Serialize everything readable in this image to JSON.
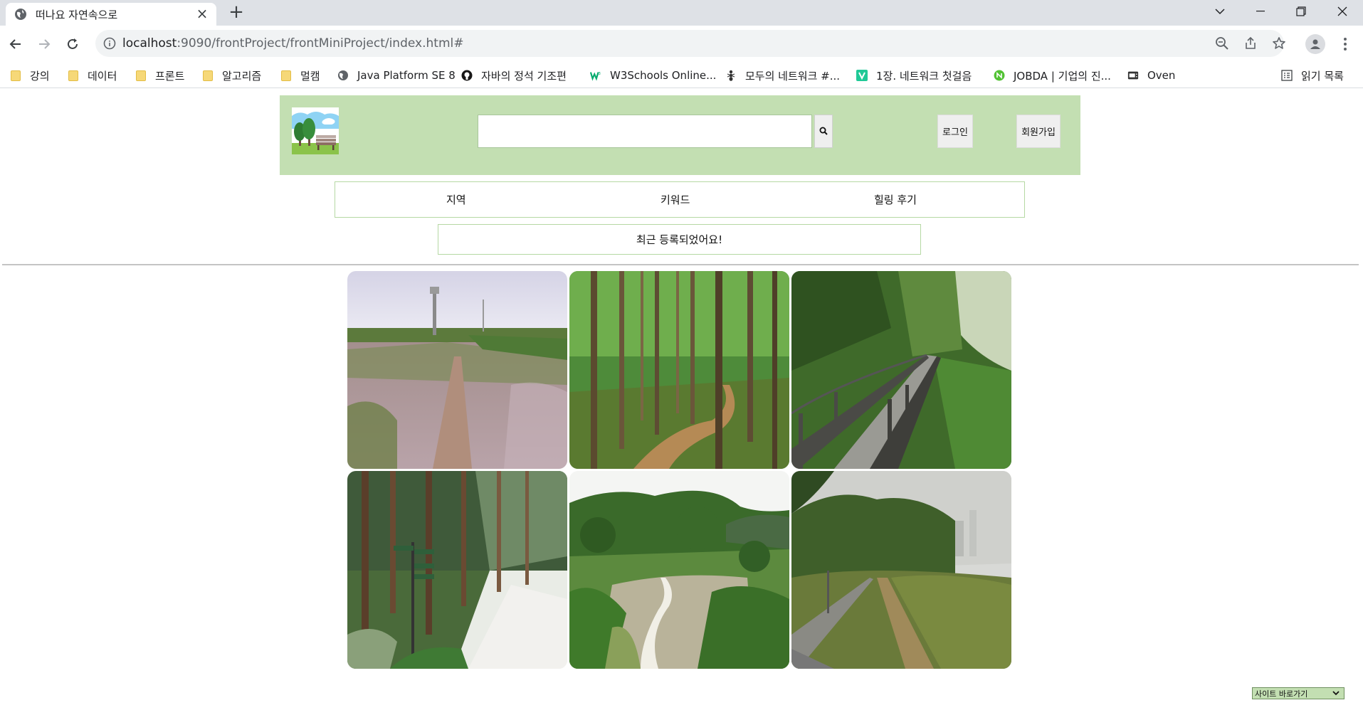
{
  "browser": {
    "tab_title": "떠나요 자연속으로",
    "url_host": "localhost",
    "url_path": ":9090/frontProject/frontMiniProject/index.html#",
    "bookmarks": [
      {
        "label": "강의",
        "icon": "folder-icon"
      },
      {
        "label": "데이터",
        "icon": "folder-icon"
      },
      {
        "label": "프론트",
        "icon": "folder-icon"
      },
      {
        "label": "알고리즘",
        "icon": "folder-icon"
      },
      {
        "label": "멀캠",
        "icon": "folder-icon"
      },
      {
        "label": "Java Platform SE 8",
        "icon": "globe-icon"
      },
      {
        "label": "자바의 정석 기조편",
        "icon": "github-icon"
      },
      {
        "label": "W3Schools Online...",
        "icon": "w3schools-icon"
      },
      {
        "label": "모두의 네트워크 #...",
        "icon": "ant-icon"
      },
      {
        "label": "1장. 네트워크 첫걸음",
        "icon": "v-icon"
      },
      {
        "label": "JOBDA | 기업의 진...",
        "icon": "jobda-icon"
      },
      {
        "label": "Oven",
        "icon": "oven-icon"
      }
    ],
    "reading_list": "읽기 목록"
  },
  "page": {
    "search": {
      "placeholder": "",
      "value": ""
    },
    "login_button": "로그인",
    "signup_button": "회원가입",
    "menu": [
      "지역",
      "키워드",
      "힐링 후기"
    ],
    "notice": "최근 등록되었어요!",
    "site_shortcut": "사이트 바로가기"
  },
  "colors": {
    "header_bg": "#c3dfb2",
    "menu_border": "#b5d8a3"
  }
}
